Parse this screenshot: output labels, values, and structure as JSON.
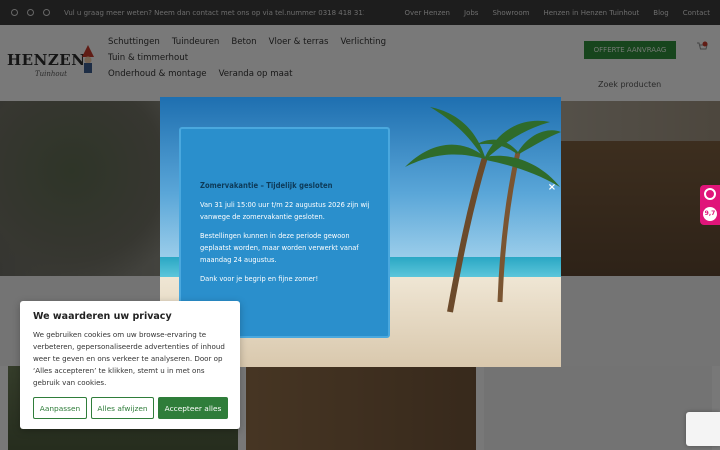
{
  "topbar": {
    "social_icons": [
      "facebook-icon",
      "pinterest-icon",
      "instagram-icon"
    ],
    "promo": "Vul u graag meer weten? Neem dan contact met ons op via tel.nummer 0318 418 311",
    "links": [
      "Over Henzen",
      "Jobs",
      "Showroom",
      "Henzen in Henzen Tuinhout",
      "Blog",
      "Contact"
    ]
  },
  "header": {
    "logo_name": "HENZEN",
    "logo_sub": "Tuinhout",
    "nav": [
      "Schuttingen",
      "Tuindeuren",
      "Beton",
      "Vloer & terras",
      "Verlichting",
      "Tuin & timmerhout",
      "Onderhoud & montage",
      "Veranda op maat"
    ],
    "offer_button": "OFFERTE AANVRAAG",
    "cart_count": "0",
    "search_placeholder": "Zoek producten"
  },
  "modal": {
    "close_label": "×",
    "title": "Zomervakantie – Tijdelijk gesloten",
    "paragraph1": "Van 31 juli 15:00 uur t/m 22 augustus 2026 zijn wij vanwege de zomervakantie gesloten.",
    "paragraph2": "Bestellingen kunnen in deze periode gewoon geplaatst worden, maar worden verwerkt vanaf maandag 24 augustus.",
    "paragraph3": "Dank voor je begrip en fijne zomer!"
  },
  "cookie": {
    "title": "We waarderen uw privacy",
    "text": "We gebruiken cookies om uw browse-ervaring te verbeteren, gepersonaliseerde advertenties of inhoud weer te geven en ons verkeer te analyseren. Door op ‘Alles accepteren’ te klikken, stemt u in met ons gebruik van cookies.",
    "btn_customize": "Aanpassen",
    "btn_reject": "Alles afwijzen",
    "btn_accept": "Accepteer alles"
  },
  "side_widget": {
    "score": "9,7"
  },
  "colors": {
    "accent_green": "#2f7d3a",
    "notice_blue": "#2a8fcc",
    "widget_pink": "#e0157a",
    "topbar": "#3a3a3a"
  }
}
